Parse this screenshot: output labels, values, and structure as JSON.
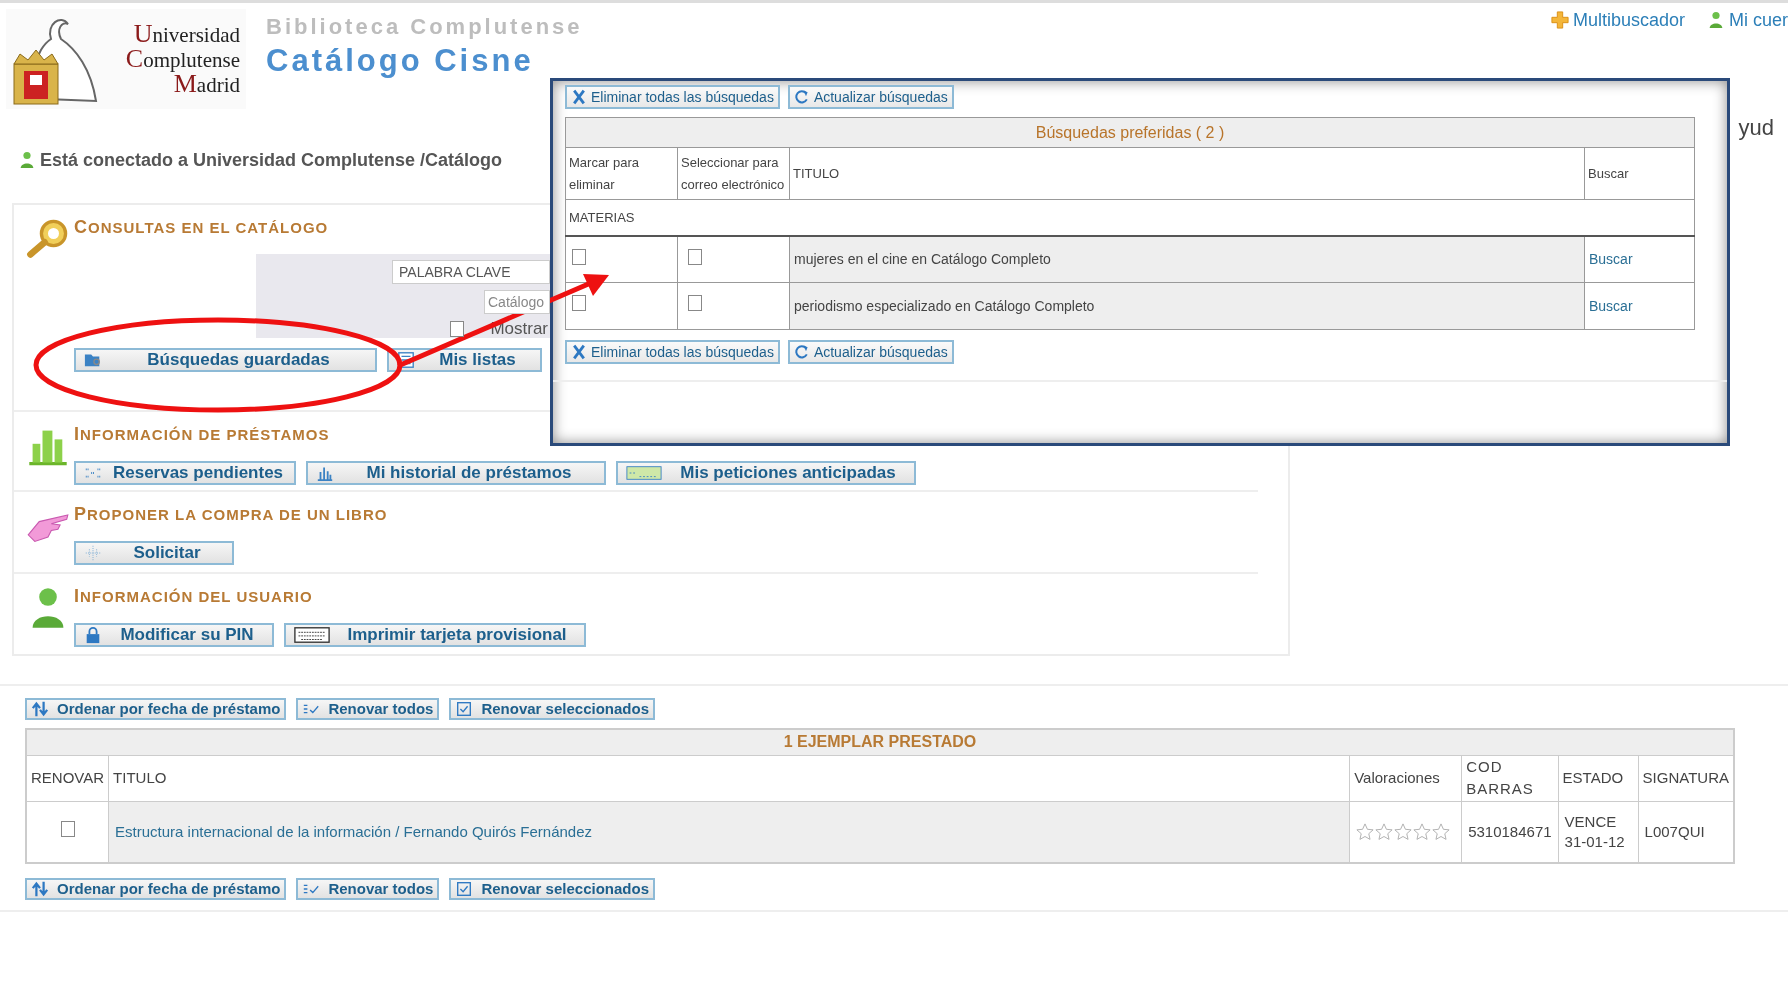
{
  "header": {
    "logo_lines": [
      "Universidad",
      "Complutense",
      "Madrid"
    ],
    "subtitle": "Biblioteca Complutense",
    "title": "Catálogo Cisne"
  },
  "top_links": [
    {
      "label": "Multibuscador"
    },
    {
      "label": "Mi cuer"
    }
  ],
  "cut_text": "yud",
  "connection": "Está conectado a Universidad Complutense /Catálogo",
  "sections": [
    {
      "kind": "search",
      "title": "CONSULTAS EN EL CATÁLOGO",
      "form": {
        "keyword": "PALABRA CLAVE",
        "catalog": "Catálogo",
        "show_label": "Mostrar",
        "show_checked": false
      },
      "buttons": [
        {
          "label": "Búsquedas guardadas"
        },
        {
          "label": "Mis listas"
        }
      ]
    },
    {
      "kind": "plain",
      "title": "INFORMACIÓN DE PRÉSTAMOS",
      "buttons": [
        {
          "label": "Reservas pendientes"
        },
        {
          "label": "Mi historial  de préstamos"
        },
        {
          "label": "Mis peticiones anticipadas"
        }
      ]
    },
    {
      "kind": "plain",
      "title": "PROPONER LA COMPRA DE UN LIBRO",
      "buttons": [
        {
          "label": "Solicitar"
        }
      ]
    },
    {
      "kind": "plain",
      "title": "INFORMACIÓN DEL USUARIO",
      "buttons": [
        {
          "label": "Modificar su PIN"
        },
        {
          "label": "Imprimir tarjeta provisional"
        }
      ]
    }
  ],
  "loans": {
    "toolbar_top": [
      {
        "label": "Ordenar por fecha de préstamo"
      },
      {
        "label": "Renovar todos"
      },
      {
        "label": "Renovar seleccionados"
      }
    ],
    "caption": "1 EJEMPLAR PRESTADO",
    "columns": [
      "RENOVAR",
      "TITULO",
      "Valoraciones",
      "COD BARRAS",
      "ESTADO",
      "SIGNATURA"
    ],
    "rows": [
      {
        "checked": false,
        "title": "Estructura internacional de la información / Fernando Quirós Fernández",
        "stars": 0,
        "barcode": "5310184671",
        "status": "VENCE 31-01-12",
        "signature": "L007QUI"
      }
    ],
    "toolbar_bottom": [
      {
        "label": "Ordenar por fecha de préstamo"
      },
      {
        "label": "Renovar todos"
      },
      {
        "label": "Renovar seleccionados"
      }
    ]
  },
  "popup": {
    "toolbar_top": [
      {
        "label": "Eliminar todas las búsquedas"
      },
      {
        "label": "Actualizar búsquedas"
      }
    ],
    "caption": "Búsquedas preferidas ( 2 )",
    "columns": [
      "Marcar para eliminar",
      "Seleccionar para correo electrónico",
      "TITULO",
      "Buscar"
    ],
    "group": "MATERIAS",
    "rows": [
      {
        "delete_checked": false,
        "email_checked": false,
        "title": "mujeres en el cine en Catálogo Completo",
        "action": "Buscar"
      },
      {
        "delete_checked": false,
        "email_checked": false,
        "title": "periodismo especializado en Catálogo Completo",
        "action": "Buscar"
      }
    ],
    "toolbar_bottom": [
      {
        "label": "Eliminar todas las búsquedas"
      },
      {
        "label": "Actualizar búsquedas"
      }
    ]
  }
}
